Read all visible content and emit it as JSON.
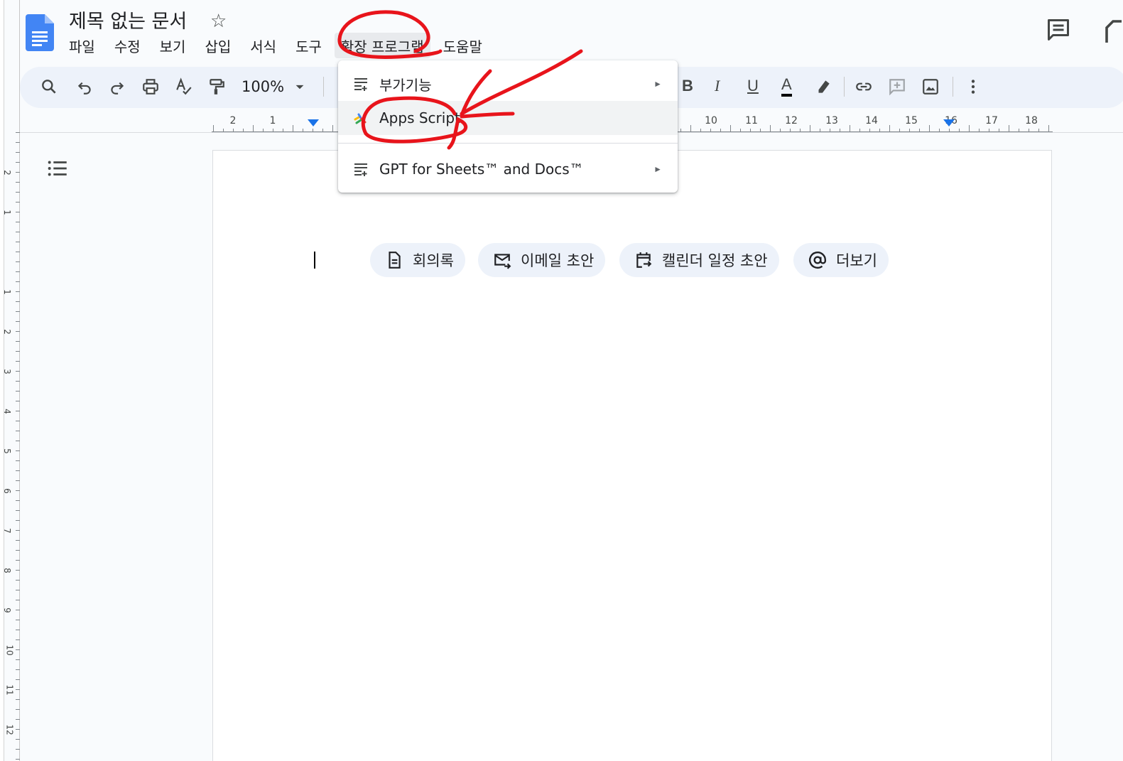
{
  "document": {
    "title": "제목 없는 문서"
  },
  "menubar": {
    "items": [
      {
        "label": "파일"
      },
      {
        "label": "수정"
      },
      {
        "label": "보기"
      },
      {
        "label": "삽입"
      },
      {
        "label": "서식"
      },
      {
        "label": "도구"
      },
      {
        "label": "확장 프로그램",
        "active": true
      },
      {
        "label": "도움말"
      }
    ]
  },
  "toolbar": {
    "zoom": "100%",
    "bold": "B",
    "italic": "I",
    "underline": "U",
    "text_color": "A"
  },
  "ruler": {
    "left_labels": [
      "2",
      "1"
    ],
    "right_labels": [
      "10",
      "11",
      "12",
      "13",
      "14",
      "15",
      "16",
      "17",
      "18"
    ],
    "vertical_labels": [
      "2",
      "1",
      "1",
      "2",
      "3",
      "4",
      "5",
      "6",
      "7",
      "8",
      "9",
      "10",
      "11",
      "12"
    ]
  },
  "extensions_menu": {
    "items": [
      {
        "label": "부가기능",
        "icon": "add-ons-icon",
        "submenu": true
      },
      {
        "label": "Apps Script",
        "icon": "apps-script-icon",
        "submenu": false
      },
      {
        "label": "GPT for Sheets™ and Docs™",
        "icon": "add-ons-icon",
        "submenu": true
      }
    ],
    "submenu_arrow": "►"
  },
  "smart_chips": [
    {
      "label": "회의록",
      "icon": "document-icon"
    },
    {
      "label": "이메일 초안",
      "icon": "mail-icon"
    },
    {
      "label": "캘린더 일정 초안",
      "icon": "calendar-icon"
    },
    {
      "label": "더보기",
      "icon": "at-sign-icon"
    }
  ],
  "colors": {
    "accent": "#1a73e8",
    "annotation": "#e8141b",
    "toolbar_bg": "#edf2fa"
  }
}
